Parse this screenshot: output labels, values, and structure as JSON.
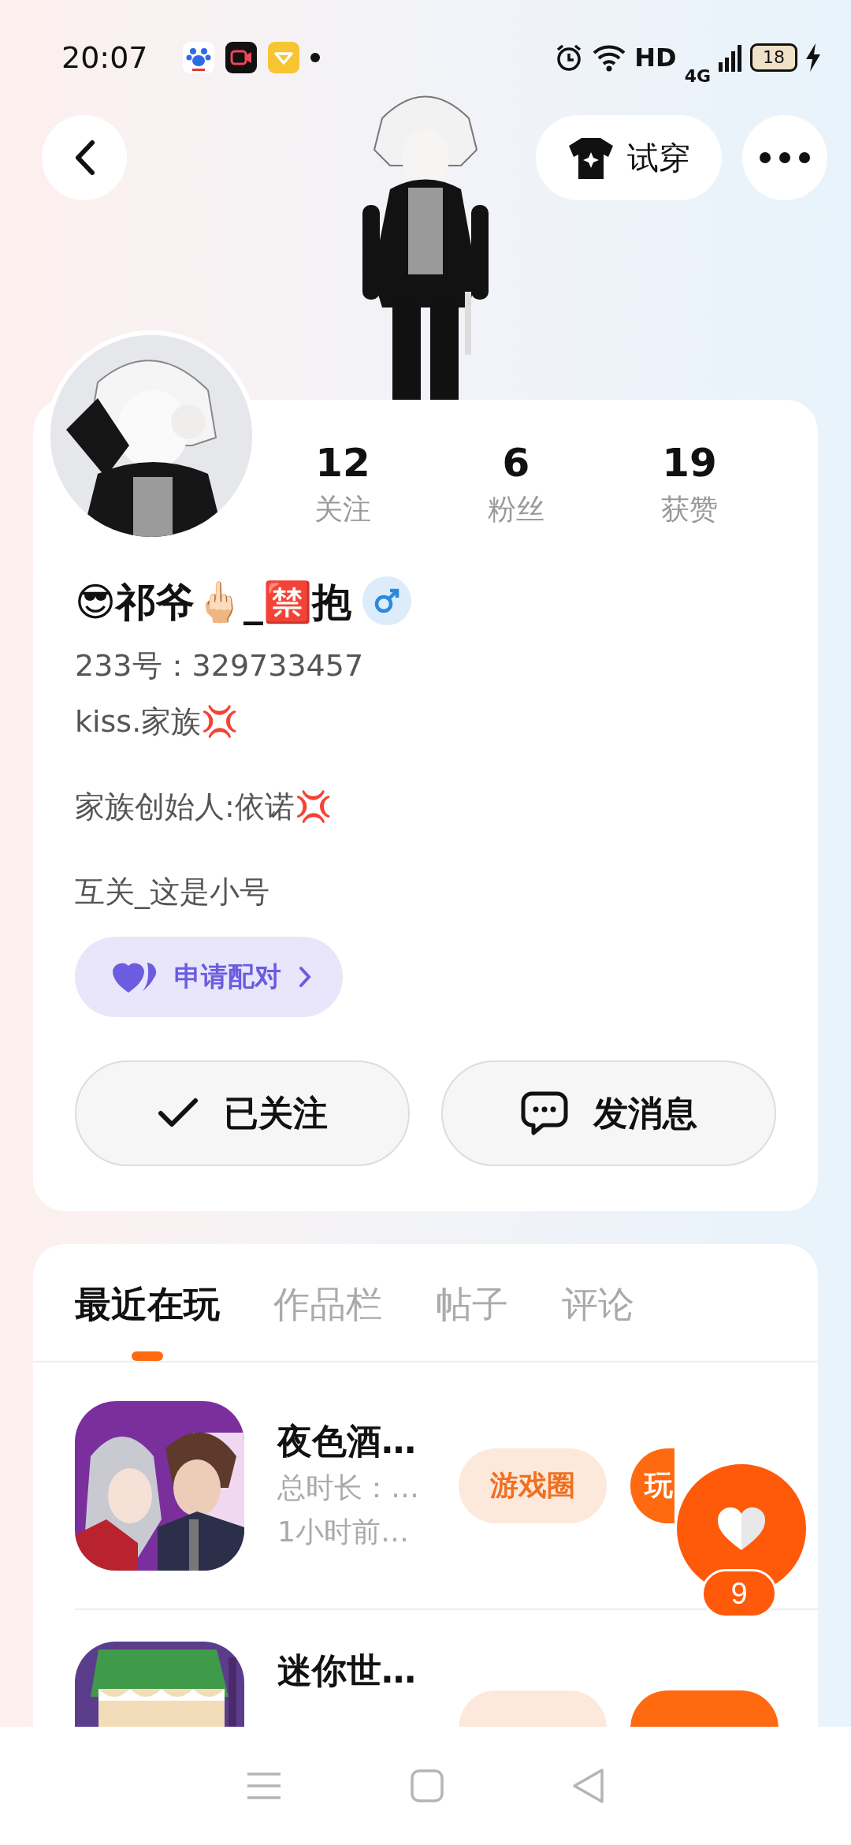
{
  "status_bar": {
    "time": "20:07",
    "network": "HD",
    "signal_type": "4G",
    "battery": "18"
  },
  "top_bar": {
    "try_on_button": "试穿"
  },
  "profile": {
    "stats": [
      {
        "value": "12",
        "label": "关注"
      },
      {
        "value": "6",
        "label": "粉丝"
      },
      {
        "value": "19",
        "label": "获赞"
      }
    ],
    "name": "😎祁爷🖕🏻_🈲抱",
    "id_line": "233号：329733457",
    "bio": [
      "kiss.家族💢",
      "家族创始人:依诺💢",
      "互关_这是小号"
    ],
    "pair_button": "申请配对",
    "follow_button": {
      "label": "已关注",
      "followed": true
    },
    "message_button": "发消息"
  },
  "tabs": [
    {
      "label": "最近在玩",
      "selected": true
    },
    {
      "label": "作品栏",
      "selected": false
    },
    {
      "label": "帖子",
      "selected": false
    },
    {
      "label": "评论",
      "selected": false
    }
  ],
  "games": [
    {
      "title": "夜色酒…",
      "duration": "总时长：…",
      "last_played": "1小时前…",
      "circle_button": "游戏圈",
      "play_button": "玩"
    },
    {
      "title": "迷你世…"
    }
  ],
  "like_fab": {
    "count": "9"
  }
}
